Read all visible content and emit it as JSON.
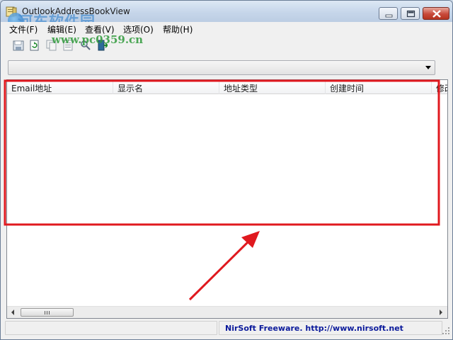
{
  "window": {
    "title": "OutlookAddressBookView"
  },
  "watermark": {
    "brand_text": "河东软件园",
    "url_text": "www.pc0359.cn"
  },
  "menubar": {
    "items": [
      {
        "label": "文件(F)"
      },
      {
        "label": "编辑(E)"
      },
      {
        "label": "查看(V)"
      },
      {
        "label": "选项(O)"
      },
      {
        "label": "帮助(H)"
      }
    ]
  },
  "toolbar": {
    "icons": [
      "save-icon",
      "refresh-icon",
      "copy-icon",
      "properties-icon",
      "search-icon",
      "exit-icon"
    ]
  },
  "address_book_select": {
    "selected_value": ""
  },
  "list": {
    "columns": [
      {
        "label": "Email地址"
      },
      {
        "label": "显示名"
      },
      {
        "label": "地址类型"
      },
      {
        "label": "创建时间"
      },
      {
        "label": "修改"
      }
    ],
    "rows": []
  },
  "statusbar": {
    "left_text": "",
    "link_text": "NirSoft Freeware.  http://www.nirsoft.net"
  },
  "annotation": {
    "highlight_color": "#e0191f"
  }
}
